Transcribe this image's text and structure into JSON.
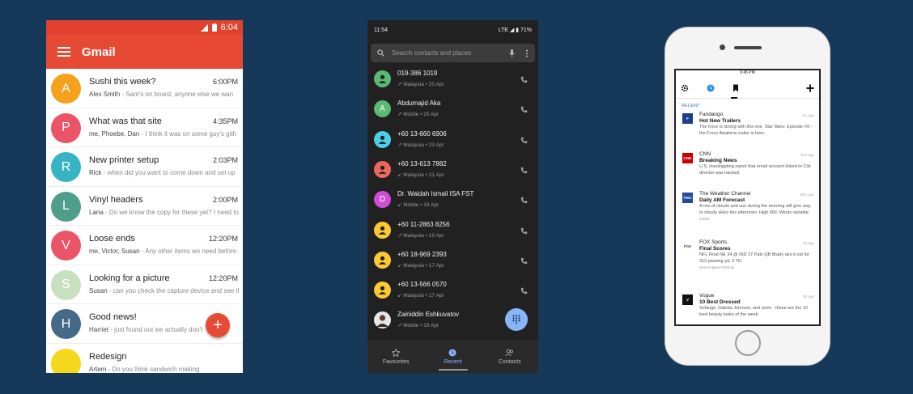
{
  "gmail": {
    "status_time": "6:04",
    "app_title": "Gmail",
    "accent": "#e64a35",
    "emails": [
      {
        "initial": "A",
        "color": "#f5a11c",
        "subject": "Sushi this week?",
        "time": "6:00PM",
        "sender": "Alex Smith",
        "snippet": " - Sam's on board, anyone else we wan"
      },
      {
        "initial": "P",
        "color": "#ea5466",
        "subject": "What was that site",
        "time": "4:35PM",
        "sender": "me, Phoebe, Dan",
        "snippet": " - I think it was on some guy's gith"
      },
      {
        "initial": "R",
        "color": "#36b4c4",
        "subject": "New printer setup",
        "time": "2:03PM",
        "sender": "Rick",
        "snippet": " - when did you want to come down and set up"
      },
      {
        "initial": "L",
        "color": "#4f9e8b",
        "subject": "Vinyl headers",
        "time": "2:00PM",
        "sender": "Lana",
        "snippet": " - Do we know the copy for these yet? I need to"
      },
      {
        "initial": "V",
        "color": "#ea5466",
        "subject": "Loose ends",
        "time": "12:20PM",
        "sender": "me, Victor, Susan",
        "snippet": " - Any other items we need before"
      },
      {
        "initial": "S",
        "color": "#c8e0c0",
        "subject": "Looking for a picture",
        "time": "12:20PM",
        "sender": "Susan",
        "snippet": " - can you check the capture device and see if"
      },
      {
        "initial": "H",
        "color": "#456a87",
        "subject": "Good news!",
        "time": "",
        "sender": "Harriet",
        "snippet": " - just found out we actually don't"
      },
      {
        "initial": "",
        "color": "#f3d81c",
        "subject": "Redesign",
        "time": "",
        "sender": "Artem",
        "snippet": " - Do you think sandwich making"
      }
    ],
    "fab_label": "+"
  },
  "dialer": {
    "status_time": "11:54",
    "status_right": "LTE ◢ ▮ 71%",
    "search_placeholder": "Search contacts and places",
    "contacts": [
      {
        "name": "019-386 1019",
        "detail": "↗ Malaysia • 25 Apr",
        "avatar": "person",
        "color": "#5bb974",
        "initial": ""
      },
      {
        "name": "Abdumajid Aka",
        "detail": "↗ Mobile • 25 Apr",
        "avatar": "letter",
        "color": "#5bb974",
        "initial": "A"
      },
      {
        "name": "+60 13-660 6906",
        "detail": "↗ Malaysia • 23 Apr",
        "avatar": "person",
        "color": "#4ecde6",
        "initial": ""
      },
      {
        "name": "+60 13-613 7882",
        "detail": "↙ Malaysia • 21 Apr",
        "avatar": "person",
        "color": "#ee675c",
        "initial": ""
      },
      {
        "name": "Dr. Waidah Ismail ISA FST",
        "detail": "↙ Mobile • 19 Apr",
        "avatar": "letter",
        "color": "#d04dd8",
        "initial": "D"
      },
      {
        "name": "+60 11-2863 8256",
        "detail": "↗ Malaysia • 19 Apr",
        "avatar": "person",
        "color": "#fcc934",
        "initial": ""
      },
      {
        "name": "+60 18-969 2393",
        "detail": "↙ Malaysia • 17 Apr",
        "avatar": "person",
        "color": "#fcc934",
        "initial": ""
      },
      {
        "name": "+60 13-566 0570",
        "detail": "↙ Malaysia • 17 Apr",
        "avatar": "person",
        "color": "#fcc934",
        "initial": ""
      },
      {
        "name": "Zainiddin Eshkuvatov",
        "detail": "↗ Mobile • 16 Apr",
        "avatar": "photo",
        "color": "#e8e8e8",
        "initial": ""
      }
    ],
    "nav": [
      {
        "label": "Favourites",
        "icon": "star-icon"
      },
      {
        "label": "Recent",
        "icon": "clock-icon"
      },
      {
        "label": "Contacts",
        "icon": "contacts-icon"
      }
    ],
    "active_color": "#8ab4f8"
  },
  "iphone": {
    "status_time": "9:45 PM",
    "section_label": "RECENT",
    "news": [
      {
        "source": "Fandango",
        "title": "Hot New Trailers",
        "body": "The force is strong with this one. Star Wars: Episode VII - the Force Awakens trailer is here.",
        "meta": "",
        "time": "1m ago",
        "logo_color": "#1c3f8c",
        "logo_text": "F"
      },
      {
        "source": "CNN",
        "title": "Breaking News",
        "body": "U.S. investigating report that email account linked to CIA director was hacked.",
        "meta": "",
        "time": "20m ago",
        "logo_color": "#cc0000",
        "logo_text": "CNN"
      },
      {
        "source": "The Weather Channel",
        "title": "Daily AM Forecast",
        "body": "A mix of clouds and sun during the morning will give way to cloudy skies this afternoon. High 56F. Winds variable.",
        "meta": "94024",
        "time": "58m ago",
        "logo_color": "#1f4c9b",
        "logo_text": "TWC"
      },
      {
        "source": "FOX Sports",
        "title": "Final Scores",
        "body": "NFL Final NE 34 @ IND 27 Pats QB Brady airs it out for 312 passing yd, 3 TD.",
        "meta": "New England Patriots",
        "time": "5h ago",
        "logo_color": "#ffffff",
        "logo_text": "FOX"
      },
      {
        "source": "Vogue",
        "title": "10 Best Dressed",
        "body": "Solange, Dakota Johnson, and more - these are the 10 best beauty looks of the week.",
        "meta": "",
        "time": "5h ago",
        "logo_color": "#111111",
        "logo_text": "V"
      }
    ]
  }
}
